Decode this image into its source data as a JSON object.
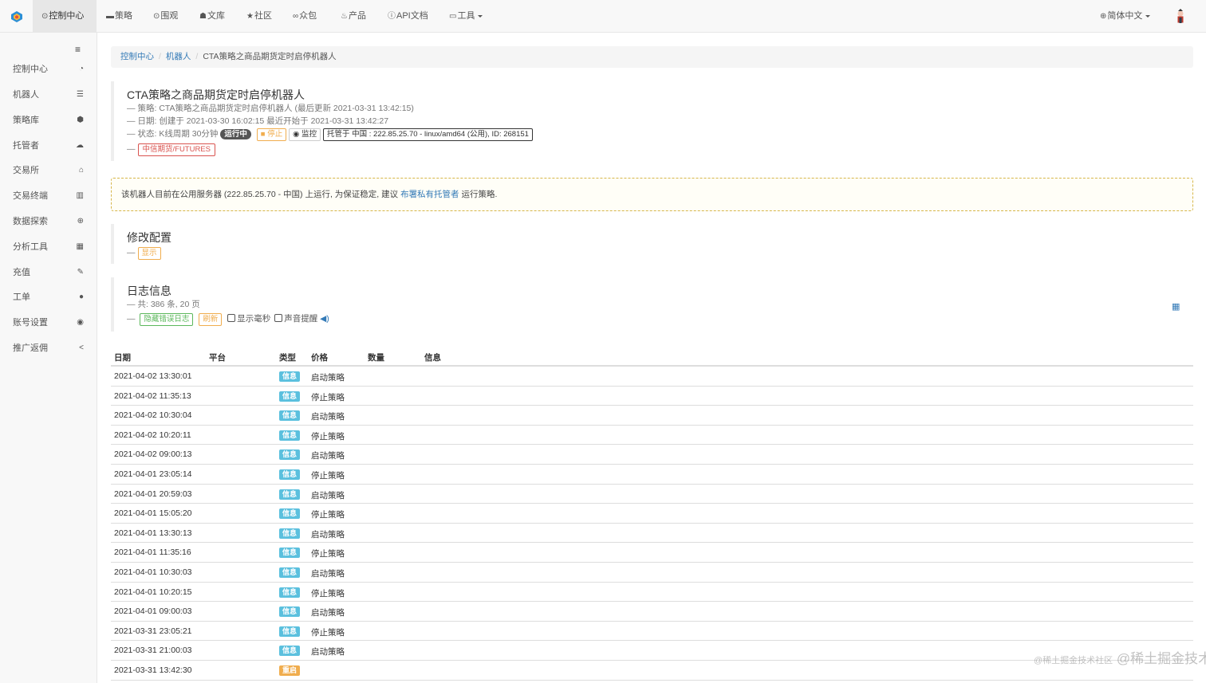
{
  "nav": {
    "items": [
      {
        "icon": "⊙",
        "label": "控制中心"
      },
      {
        "icon": "▬",
        "label": "策略"
      },
      {
        "icon": "⊙",
        "label": "围观"
      },
      {
        "icon": "☗",
        "label": "文库"
      },
      {
        "icon": "★",
        "label": "社区"
      },
      {
        "icon": "∞",
        "label": "众包"
      },
      {
        "icon": "♨",
        "label": "产品"
      },
      {
        "icon": "ⓘ",
        "label": "API文档"
      },
      {
        "icon": "▭",
        "label": "工具"
      }
    ],
    "language": {
      "icon": "⊕",
      "label": "简体中文"
    }
  },
  "sidebar": {
    "toggle": "≡",
    "items": [
      {
        "label": "控制中心",
        "icon": "◔"
      },
      {
        "label": "机器人",
        "icon": "☰"
      },
      {
        "label": "策略库",
        "icon": "⬢"
      },
      {
        "label": "托管者",
        "icon": "☁"
      },
      {
        "label": "交易所",
        "icon": "⌂"
      },
      {
        "label": "交易终端",
        "icon": "▥"
      },
      {
        "label": "数据探索",
        "icon": "⊕"
      },
      {
        "label": "分析工具",
        "icon": "▦"
      },
      {
        "label": "充值",
        "icon": "✎"
      },
      {
        "label": "工单",
        "icon": "●"
      },
      {
        "label": "账号设置",
        "icon": "◉"
      },
      {
        "label": "推广返佣",
        "icon": "<"
      }
    ]
  },
  "breadcrumb": {
    "home": "控制中心",
    "section": "机器人",
    "current": "CTA策略之商品期货定时启停机器人"
  },
  "robot": {
    "title": "CTA策略之商品期货定时启停机器人",
    "strategy_line": "策略: CTA策略之商品期货定时启停机器人 (最后更新 2021-03-31 13:42:15)",
    "date_line": "日期: 创建于 2021-03-30 16:02:15 最近开始于 2021-03-31 13:42:27",
    "status_prefix": "状态: K线周期 30分钟",
    "status_badge": "运行中",
    "stop_button": "停止",
    "monitor_button": "监控",
    "host_info": "托管于 中国 : 222.85.25.70 - linux/amd64 (公用), ID: 268151",
    "exchange_label": "中信期货/FUTURES"
  },
  "alert": {
    "text_before": "该机器人目前在公用服务器 (222.85.25.70 - 中国) 上运行, 为保证稳定, 建议",
    "link": "布署私有托管者",
    "text_after": "运行策略."
  },
  "config": {
    "title": "修改配置",
    "show_button": "显示"
  },
  "logs": {
    "title": "日志信息",
    "summary": "共: 386 条, 20 页",
    "hide_errors_button": "隐藏错误日志",
    "refresh_button": "刷新",
    "show_ms_label": "显示毫秒",
    "sound_label": "声音提醒",
    "columns": [
      "日期",
      "平台",
      "类型",
      "价格",
      "数量",
      "信息"
    ],
    "rows": [
      {
        "date": "2021-04-02 13:30:01",
        "type": "信息",
        "msg": "启动策略"
      },
      {
        "date": "2021-04-02 11:35:13",
        "type": "信息",
        "msg": "停止策略"
      },
      {
        "date": "2021-04-02 10:30:04",
        "type": "信息",
        "msg": "启动策略"
      },
      {
        "date": "2021-04-02 10:20:11",
        "type": "信息",
        "msg": "停止策略"
      },
      {
        "date": "2021-04-02 09:00:13",
        "type": "信息",
        "msg": "启动策略"
      },
      {
        "date": "2021-04-01 23:05:14",
        "type": "信息",
        "msg": "停止策略"
      },
      {
        "date": "2021-04-01 20:59:03",
        "type": "信息",
        "msg": "启动策略"
      },
      {
        "date": "2021-04-01 15:05:20",
        "type": "信息",
        "msg": "停止策略"
      },
      {
        "date": "2021-04-01 13:30:13",
        "type": "信息",
        "msg": "启动策略"
      },
      {
        "date": "2021-04-01 11:35:16",
        "type": "信息",
        "msg": "停止策略"
      },
      {
        "date": "2021-04-01 10:30:03",
        "type": "信息",
        "msg": "启动策略"
      },
      {
        "date": "2021-04-01 10:20:15",
        "type": "信息",
        "msg": "停止策略"
      },
      {
        "date": "2021-04-01 09:00:03",
        "type": "信息",
        "msg": "启动策略"
      },
      {
        "date": "2021-03-31 23:05:21",
        "type": "信息",
        "msg": "停止策略"
      },
      {
        "date": "2021-03-31 21:00:03",
        "type": "信息",
        "msg": "启动策略"
      },
      {
        "date": "2021-03-31 13:42:30",
        "type": "重启",
        "msg": ""
      }
    ]
  },
  "colors": {
    "info_tag": "#5bc0de",
    "restart_tag": "#f0ad4e",
    "link": "#337ab7"
  },
  "watermark": {
    "small": "@稀土掘金技术社区",
    "big": "@稀土掘金技术社区"
  }
}
